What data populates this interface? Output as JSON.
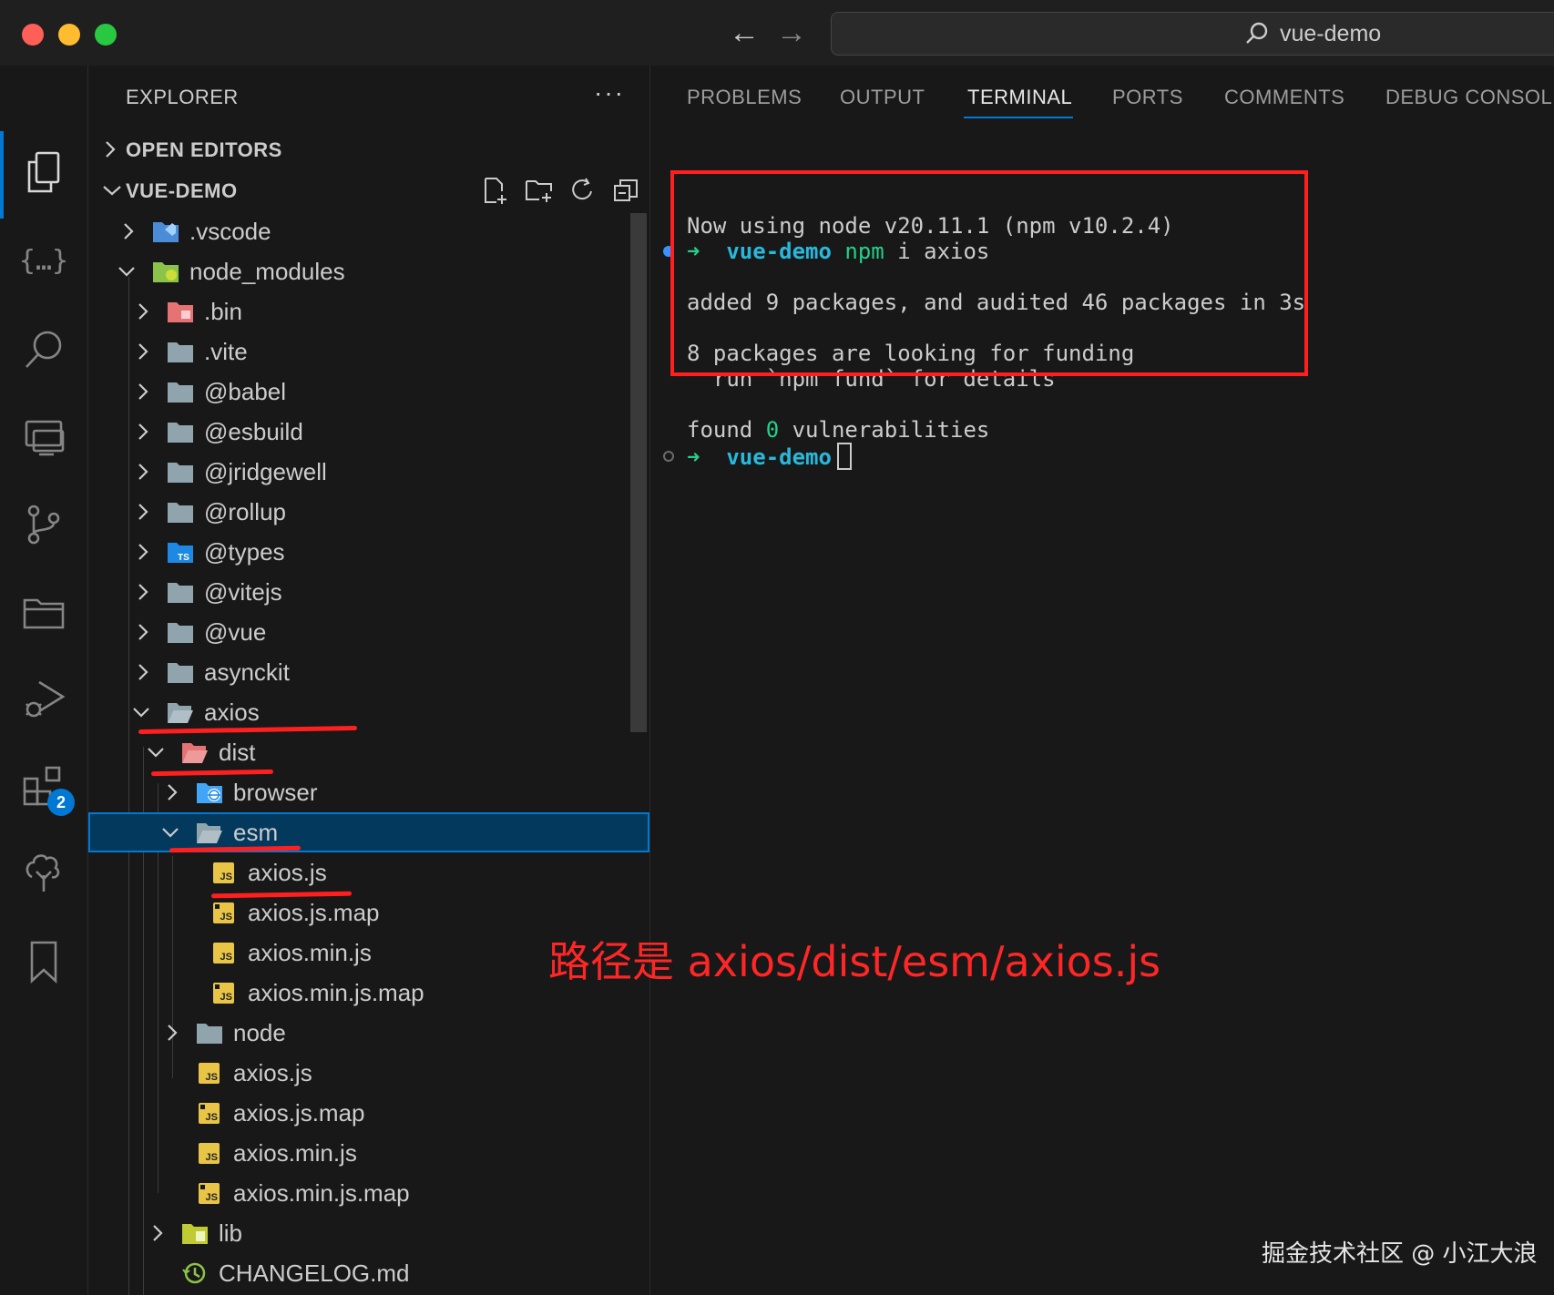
{
  "titlebar": {
    "back_arrow": "←",
    "forward_arrow": "→",
    "search_text": "vue-demo"
  },
  "activity_bar": {
    "icons": [
      "explorer-icon",
      "json-icon",
      "search-icon",
      "remote-explorer-icon",
      "source-control-icon",
      "folder-icon",
      "run-debug-icon",
      "extensions-icon",
      "tree-icon",
      "bookmark-icon"
    ],
    "braces": "{…}",
    "extensions_badge": "2"
  },
  "explorer": {
    "title": "EXPLORER",
    "more": "···",
    "open_editors": "OPEN EDITORS",
    "project": "VUE-DEMO",
    "tree": [
      {
        "label": ".vscode",
        "icon": "vscode-folder"
      },
      {
        "label": "node_modules",
        "icon": "node-folder"
      },
      {
        "label": ".bin",
        "icon": "bin-folder"
      },
      {
        "label": ".vite",
        "icon": "folder"
      },
      {
        "label": "@babel",
        "icon": "folder"
      },
      {
        "label": "@esbuild",
        "icon": "folder"
      },
      {
        "label": "@jridgewell",
        "icon": "folder"
      },
      {
        "label": "@rollup",
        "icon": "folder"
      },
      {
        "label": "@types",
        "icon": "ts-folder"
      },
      {
        "label": "@vitejs",
        "icon": "folder"
      },
      {
        "label": "@vue",
        "icon": "folder"
      },
      {
        "label": "asynckit",
        "icon": "folder"
      },
      {
        "label": "axios",
        "icon": "folder-open"
      },
      {
        "label": "dist",
        "icon": "dist-folder-open"
      },
      {
        "label": "browser",
        "icon": "browser-folder"
      },
      {
        "label": "esm",
        "icon": "folder-open"
      },
      {
        "label": "axios.js",
        "icon": "js-file"
      },
      {
        "label": "axios.js.map",
        "icon": "js-map-file"
      },
      {
        "label": "axios.min.js",
        "icon": "js-file"
      },
      {
        "label": "axios.min.js.map",
        "icon": "js-map-file"
      },
      {
        "label": "node",
        "icon": "folder"
      },
      {
        "label": "axios.js",
        "icon": "js-file"
      },
      {
        "label": "axios.js.map",
        "icon": "js-map-file"
      },
      {
        "label": "axios.min.js",
        "icon": "js-file"
      },
      {
        "label": "axios.min.js.map",
        "icon": "js-map-file"
      },
      {
        "label": "lib",
        "icon": "lib-folder"
      },
      {
        "label": "CHANGELOG.md",
        "icon": "changelog-file"
      }
    ]
  },
  "panel": {
    "tabs": [
      "PROBLEMS",
      "OUTPUT",
      "TERMINAL",
      "PORTS",
      "COMMENTS",
      "DEBUG CONSOLE"
    ],
    "active_tab": "TERMINAL",
    "terminal": {
      "line_node": "Now using node v20.11.1 (npm v10.2.4)",
      "prompt_arrow": "➜",
      "prompt_dir": "vue-demo",
      "cmd_npm": "npm",
      "cmd_rest": "i axios",
      "line_added": "added 9 packages, and audited 46 packages in 3s",
      "line_funding": "8 packages are looking for funding",
      "line_fund_run": "  run `npm fund` for details",
      "line_found_a": "found ",
      "line_found_zero": "0",
      "line_found_b": " vulnerabilities"
    }
  },
  "annotation": {
    "text": "路径是 axios/dist/esm/axios.js",
    "color": "#ff2626"
  },
  "watermark": "掘金技术社区 @ 小江大浪",
  "colors": {
    "accent": "#0078d4",
    "annotation_red": "#ff1f1f",
    "terminal_green": "#23d18b",
    "terminal_cyan": "#29b8db"
  }
}
